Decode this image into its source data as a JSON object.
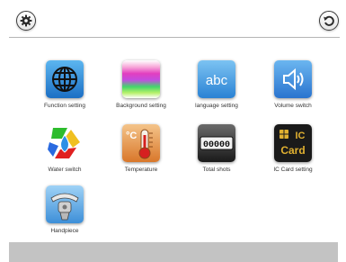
{
  "header": {
    "settings_icon": "gear-icon",
    "back_icon": "refresh-back-icon"
  },
  "menu": {
    "items": [
      {
        "label": "Function setting",
        "icon": "globe-icon"
      },
      {
        "label": "Background setting",
        "icon": "color-bands-icon"
      },
      {
        "label": "language setting",
        "icon": "abc-icon"
      },
      {
        "label": "Volume switch",
        "icon": "speaker-icon"
      },
      {
        "label": "Water switch",
        "icon": "recycle-water-icon"
      },
      {
        "label": "Temperature",
        "icon": "thermometer-icon"
      },
      {
        "label": "Total shots",
        "icon": "counter-icon"
      },
      {
        "label": "IC Card setting",
        "icon": "ic-card-icon"
      },
      {
        "label": "Handpiece",
        "icon": "handpiece-icon"
      }
    ],
    "abc_text": "abc",
    "counter_text": "00000",
    "ic_text": "IC",
    "card_text": "Card",
    "celsius_text": "°C"
  },
  "colors": {
    "tile_blue": "#2f84d6",
    "footer_gray": "#c3c3c3"
  }
}
